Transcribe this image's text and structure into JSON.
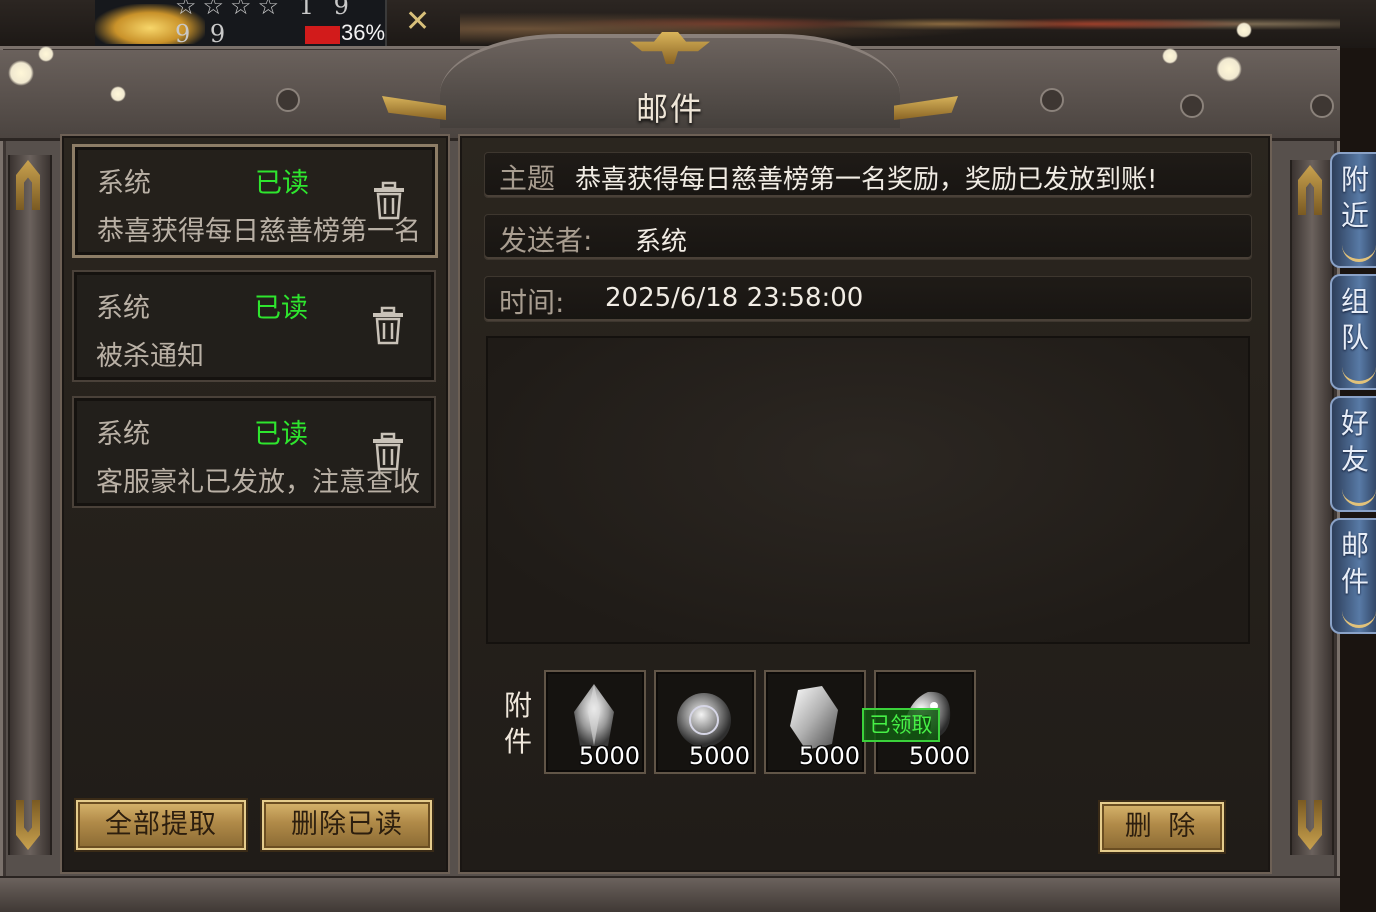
{
  "hud": {
    "stars": "☆☆☆☆ 1 9 9 9",
    "percent": "36%"
  },
  "window": {
    "title": "邮件"
  },
  "mail_list": [
    {
      "sender": "系统",
      "status": "已读",
      "subject": "恭喜获得每日慈善榜第一名"
    },
    {
      "sender": "系统",
      "status": "已读",
      "subject": "被杀通知"
    },
    {
      "sender": "系统",
      "status": "已读",
      "subject": "客服豪礼已发放，注意查收"
    }
  ],
  "buttons": {
    "claim_all": "全部提取",
    "delete_read": "删除已读",
    "delete": "删 除"
  },
  "detail": {
    "subject_label": "主题",
    "subject_value": "恭喜获得每日慈善榜第一名奖励，奖励已发放到账!",
    "sender_label": "发送者:",
    "sender_value": "系统",
    "time_label": "时间:",
    "time_value": "2025/6/18 23:58:00",
    "body": ""
  },
  "attachments": {
    "label": "附件",
    "items": [
      {
        "icon": "crystal-gem-icon",
        "count": "5000",
        "claimed_label": ""
      },
      {
        "icon": "silver-orb-icon",
        "count": "5000",
        "claimed_label": ""
      },
      {
        "icon": "quartz-stone-icon",
        "count": "5000",
        "claimed_label": ""
      },
      {
        "icon": "silver-dragon-icon",
        "count": "5000",
        "claimed_label": "已领取"
      }
    ]
  },
  "side_tabs": [
    {
      "label": "附近"
    },
    {
      "label": "组队"
    },
    {
      "label": "好友"
    },
    {
      "label": "邮件"
    }
  ],
  "colors": {
    "read_status": "#2ee52e",
    "gold_button": "#b08a48",
    "panel_bg": "#221f1b"
  }
}
